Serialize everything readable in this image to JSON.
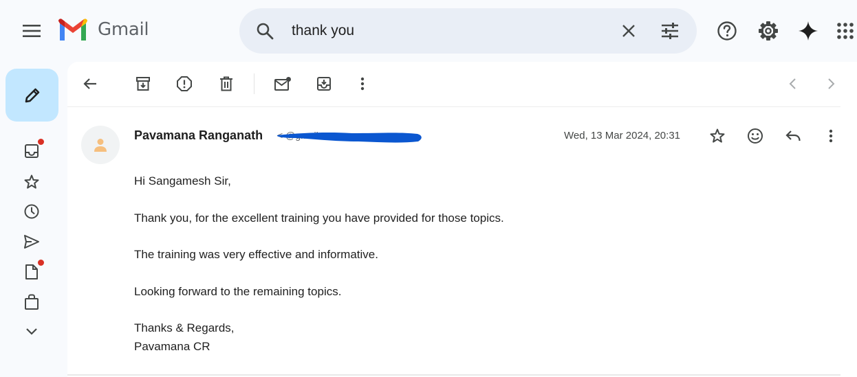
{
  "app": {
    "name": "Gmail"
  },
  "search": {
    "query": "thank you"
  },
  "message": {
    "sender_name": "Pavamana Ranganath",
    "sender_email": "<                @gmail.com>",
    "date": "Wed, 13 Mar 2024, 20:31",
    "body": {
      "greeting": "Hi Sangamesh Sir,",
      "line1": "Thank you, for the excellent training you have provided for those topics.",
      "line2": "The training was very effective and informative.",
      "line3": "Looking forward to the remaining topics.",
      "closing": "Thanks & Regards,",
      "signature": "Pavamana CR"
    }
  },
  "colors": {
    "background": "#f8fafd",
    "search_bg": "#e9eef6",
    "compose_bg": "#c2e7ff",
    "unread_dot": "#d93025",
    "redaction": "#0b57d0"
  },
  "icons": {
    "topbar": [
      "menu-icon",
      "gmail-logo",
      "search-icon",
      "clear-icon",
      "search-options-icon",
      "help-icon",
      "settings-icon",
      "gemini-icon",
      "apps-icon"
    ],
    "sidebar": [
      "pencil-icon",
      "inbox-icon",
      "star-icon",
      "clock-icon",
      "send-icon",
      "draft-icon",
      "bag-icon",
      "chevron-down-icon"
    ],
    "toolbar": [
      "back-arrow-icon",
      "archive-icon",
      "report-spam-icon",
      "delete-icon",
      "mark-unread-icon",
      "move-to-icon",
      "more-vert-icon",
      "chevron-left-icon",
      "chevron-right-icon"
    ],
    "message": [
      "person-icon",
      "star-icon",
      "emoji-icon",
      "reply-icon",
      "more-vert-icon"
    ]
  }
}
